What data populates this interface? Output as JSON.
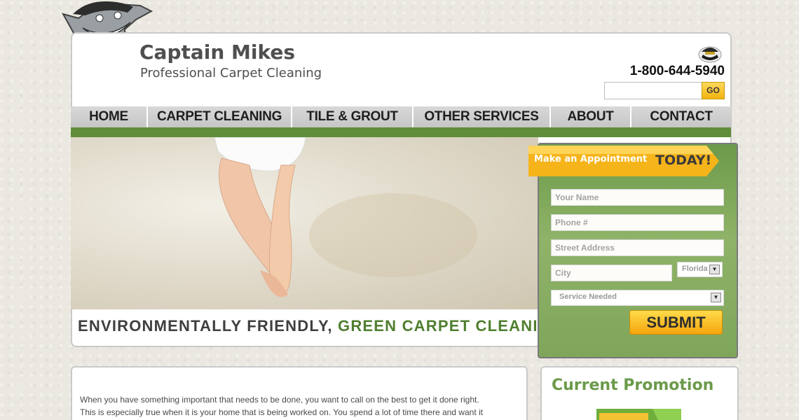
{
  "header": {
    "brand_name": "Captain Mikes",
    "brand_tagline": "Professional Carpet Cleaning",
    "phone": "1-800-644-5940",
    "search": {
      "placeholder": "",
      "go_label": "GO"
    }
  },
  "nav": {
    "items": [
      {
        "label": "HOME"
      },
      {
        "label": "CARPET CLEANING"
      },
      {
        "label": "TILE & GROUT"
      },
      {
        "label": "OTHER SERVICES"
      },
      {
        "label": "ABOUT"
      },
      {
        "label": "CONTACT"
      }
    ]
  },
  "hero": {
    "tagline_part1": "ENVIRONMENTALLY FRIENDLY,",
    "tagline_part2": "GREEN CARPET CLEANING"
  },
  "appointment": {
    "banner_text": "Make an Appointment",
    "banner_emphasis": "TODAY!",
    "fields": {
      "name": "Your Name",
      "phone": "Phone #",
      "address": "Street Address",
      "city": "City"
    },
    "state_selected": "Florida",
    "service_selected": "Service Needed",
    "submit_label": "SUBMIT"
  },
  "content": {
    "line1": "When you have something important that needs to be done, you want to call on the best to get it done right.",
    "line2": "This is especially true when it is your home that is being worked on. You spend a lot of time there and want it"
  },
  "promo": {
    "title": "Current Promotion"
  },
  "colors": {
    "nav_green": "#5f8d3b",
    "tag_green": "#4f7f2f",
    "panel_green": "#7fa65b",
    "button_yellow": "#f5b514"
  }
}
